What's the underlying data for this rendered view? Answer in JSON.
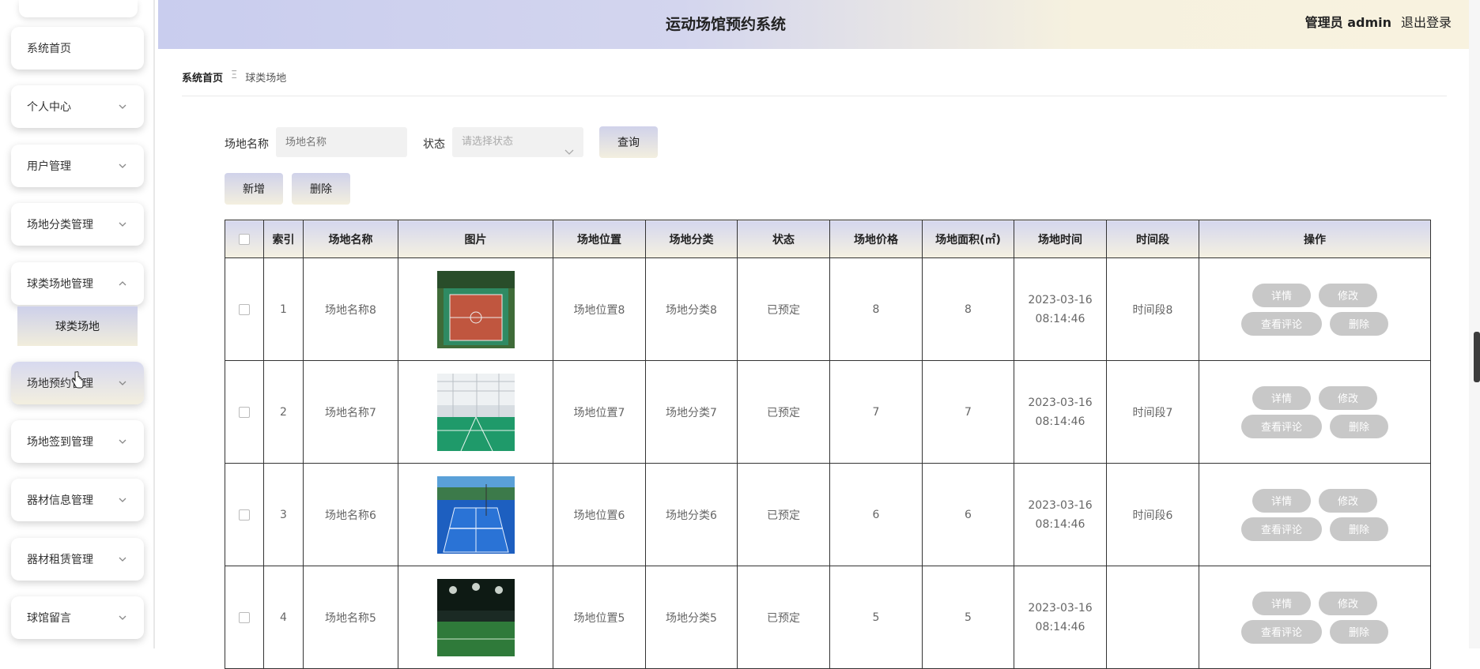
{
  "app": {
    "title": "运动场馆预约系统",
    "user": "管理员 admin",
    "logout": "退出登录"
  },
  "sidebar": {
    "items": [
      {
        "label": "系统首页"
      },
      {
        "label": "个人中心"
      },
      {
        "label": "用户管理"
      },
      {
        "label": "场地分类管理"
      },
      {
        "label": "球类场地管理",
        "expanded": true
      },
      {
        "label": "场地预约管理"
      },
      {
        "label": "场地签到管理"
      },
      {
        "label": "器材信息管理"
      },
      {
        "label": "器材租赁管理"
      },
      {
        "label": "球馆留言"
      }
    ],
    "sub_item": "球类场地"
  },
  "breadcrumb": {
    "home": "系统首页",
    "sep": "Ξ",
    "current": "球类场地"
  },
  "search": {
    "name_label": "场地名称",
    "name_placeholder": "场地名称",
    "status_label": "状态",
    "status_placeholder": "请选择状态",
    "query": "查询"
  },
  "actions": {
    "add": "新增",
    "delete": "删除"
  },
  "table": {
    "headers": [
      "",
      "索引",
      "场地名称",
      "图片",
      "场地位置",
      "场地分类",
      "状态",
      "场地价格",
      "场地面积(㎡)",
      "场地时间",
      "时间段",
      "操作"
    ],
    "rows": [
      {
        "index": "1",
        "name": "场地名称8",
        "location": "场地位置8",
        "category": "场地分类8",
        "status": "已预定",
        "price": "8",
        "area": "8",
        "time": "2023-03-16 08:14:46",
        "period": "时间段8"
      },
      {
        "index": "2",
        "name": "场地名称7",
        "location": "场地位置7",
        "category": "场地分类7",
        "status": "已预定",
        "price": "7",
        "area": "7",
        "time": "2023-03-16 08:14:46",
        "period": "时间段7"
      },
      {
        "index": "3",
        "name": "场地名称6",
        "location": "场地位置6",
        "category": "场地分类6",
        "status": "已预定",
        "price": "6",
        "area": "6",
        "time": "2023-03-16 08:14:46",
        "period": "时间段6"
      },
      {
        "index": "4",
        "name": "场地名称5",
        "location": "场地位置5",
        "category": "场地分类5",
        "status": "已预定",
        "price": "5",
        "area": "5",
        "time": "2023-03-16 08:14:46",
        "period": ""
      }
    ],
    "ops": {
      "detail": "详情",
      "edit": "修改",
      "comments": "查看评论",
      "delete": "删除"
    }
  },
  "colors": {
    "accent_start": "#c9cdee",
    "accent_end": "#f8f2df",
    "op_button": "#c8c8c8"
  }
}
